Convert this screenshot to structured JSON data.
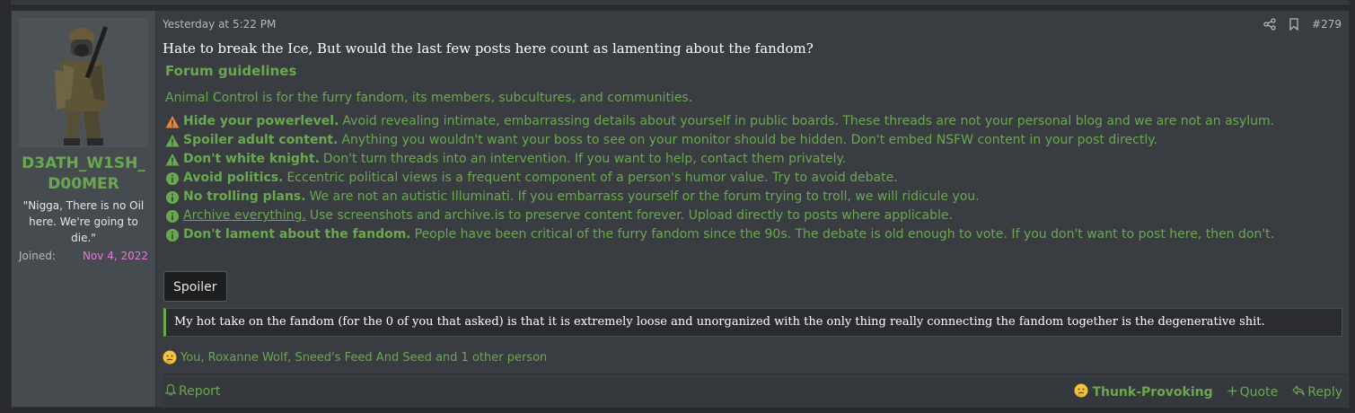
{
  "post": {
    "date": "Yesterday at 5:22 PM",
    "number": "#279",
    "body": "Hate to break the Ice, But would the last few posts here count as lamenting about the fandom?"
  },
  "user": {
    "name": "D3ATH_W1SH_D00MER",
    "title": "\"Nigga, There is no Oil here. We're going to die.\"",
    "joined_label": "Joined:",
    "joined_date": "Nov 4, 2022"
  },
  "guidelines": {
    "title": "Forum guidelines",
    "intro": "Animal Control is for the furry fandom, its members, subcultures, and communities.",
    "rules": [
      {
        "icon": "warning-icon",
        "color": "#e8833a",
        "bold": "Hide your powerlevel.",
        "text": "Avoid revealing intimate, embarrassing details about yourself in public boards. These threads are not your personal blog and we are not an asylum."
      },
      {
        "icon": "warning-icon",
        "color": "#6aa84f",
        "bold": "Spoiler adult content.",
        "text": "Anything you wouldn't want your boss to see on your monitor should be hidden. Don't embed NSFW content in your post directly."
      },
      {
        "icon": "warning-icon",
        "color": "#6aa84f",
        "bold": "Don't white knight.",
        "text": "Don't turn threads into an intervention. If you want to help, contact them privately."
      },
      {
        "icon": "info-icon",
        "color": "#6aa84f",
        "bold": "Avoid politics.",
        "text": "Eccentric political views is a frequent component of a person's humor value. Try to avoid debate."
      },
      {
        "icon": "info-icon",
        "color": "#6aa84f",
        "bold": "No trolling plans.",
        "text": "We are not an autistic Illuminati. If you embarrass yourself or the forum trying to troll, we will ridicule you."
      },
      {
        "icon": "info-icon",
        "color": "#6aa84f",
        "link": "Archive everything.",
        "text": "Use screenshots and archive.is to preserve content forever. Upload directly to posts where applicable."
      },
      {
        "icon": "info-icon",
        "color": "#6aa84f",
        "bold": "Don't lament about the fandom.",
        "text": "People have been critical of the furry fandom since the 90s. The debate is old enough to vote. If you don't want to post here, then don't."
      }
    ]
  },
  "spoiler": {
    "label": "Spoiler"
  },
  "quote": {
    "text": "My hot take on the fandom (for the 0 of you that asked) is that it is extremely loose and unorganized with the only thing really connecting the fandom together is the degenerative shit."
  },
  "reactions": {
    "summary": "You, Roxanne Wolf, Sneed's Feed And Seed and 1 other person"
  },
  "footer": {
    "report": "Report",
    "reaction_label": "Thunk-Provoking",
    "quote": "Quote",
    "reply": "Reply"
  },
  "colors": {
    "accent": "#6aa84f",
    "warning": "#e8833a",
    "joined_date": "#e07ad8"
  }
}
